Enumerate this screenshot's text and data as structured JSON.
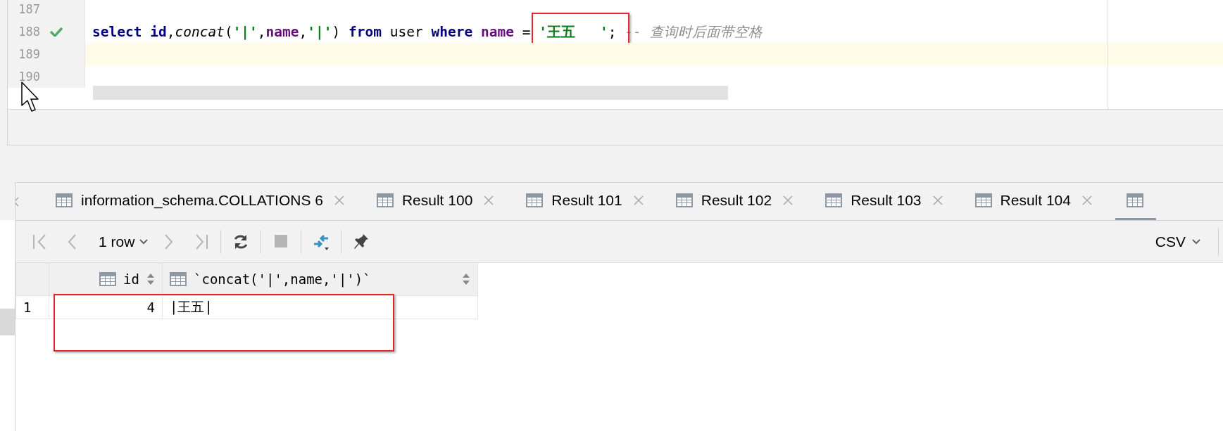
{
  "editor": {
    "lines": [
      {
        "number": "187",
        "checked": false,
        "current": false
      },
      {
        "number": "188",
        "checked": true,
        "current": false,
        "tokens": [
          {
            "kind": "keyword",
            "text": "select "
          },
          {
            "kind": "keyword",
            "text": "id"
          },
          {
            "kind": "plain",
            "text": ","
          },
          {
            "kind": "function",
            "text": "concat"
          },
          {
            "kind": "plain",
            "text": "("
          },
          {
            "kind": "string",
            "text": "'|'"
          },
          {
            "kind": "plain",
            "text": ","
          },
          {
            "kind": "field",
            "text": "name"
          },
          {
            "kind": "plain",
            "text": ","
          },
          {
            "kind": "string",
            "text": "'|'"
          },
          {
            "kind": "plain",
            "text": ") "
          },
          {
            "kind": "keyword",
            "text": "from"
          },
          {
            "kind": "plain",
            "text": " user "
          },
          {
            "kind": "keyword",
            "text": "where "
          },
          {
            "kind": "field",
            "text": "name"
          },
          {
            "kind": "plain",
            "text": " = "
          },
          {
            "kind": "string",
            "text": "'王五   '",
            "highlighted": true
          },
          {
            "kind": "plain",
            "text": "; "
          },
          {
            "kind": "comment",
            "text": "-- 查询时后面带空格"
          }
        ]
      },
      {
        "number": "189",
        "checked": false,
        "current": true
      },
      {
        "number": "190",
        "checked": false,
        "current": false
      }
    ]
  },
  "tabs": [
    {
      "label": "information_schema.COLLATIONS 6",
      "selected": false
    },
    {
      "label": "Result 100",
      "selected": false
    },
    {
      "label": "Result 101",
      "selected": false
    },
    {
      "label": "Result 102",
      "selected": false
    },
    {
      "label": "Result 103",
      "selected": false
    },
    {
      "label": "Result 104",
      "selected": false
    },
    {
      "selected": true
    }
  ],
  "toolbar": {
    "nav": [
      {
        "kind": "first",
        "disabled": true
      },
      {
        "kind": "prev",
        "disabled": true
      }
    ],
    "row_count": "1 row",
    "nav_after": [
      {
        "kind": "next",
        "disabled": true
      },
      {
        "kind": "last",
        "disabled": true
      }
    ],
    "actions": [
      {
        "kind": "refresh",
        "disabled": false
      },
      {
        "kind": "stop",
        "disabled": true
      },
      {
        "kind": "compare",
        "disabled": false
      },
      {
        "kind": "pin",
        "disabled": false
      }
    ],
    "export": "CSV"
  },
  "grid": {
    "columns": [
      {
        "label": "id",
        "kind": "number"
      },
      {
        "label": "`concat('|',name,'|')`",
        "kind": "text"
      }
    ],
    "rows": [
      {
        "number": "1",
        "cells": [
          "4",
          "|王五|"
        ],
        "highlighted": true
      }
    ]
  }
}
